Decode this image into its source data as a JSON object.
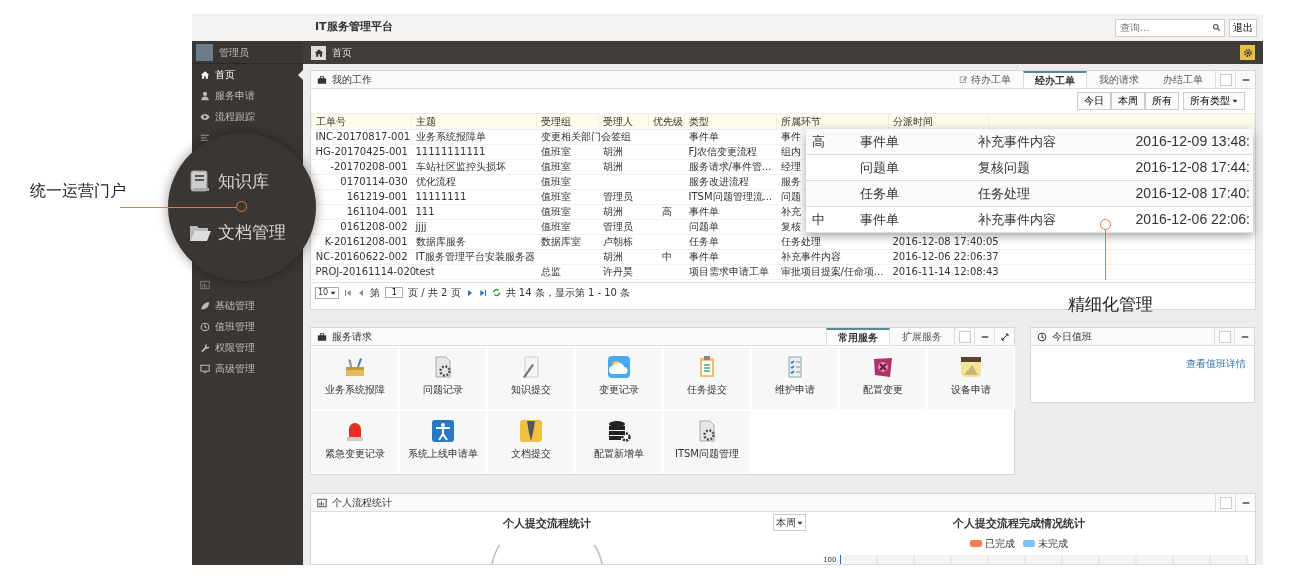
{
  "header": {
    "title": "IT服务管理平台",
    "search": {
      "placeholder": "查询..."
    },
    "logout": "退出"
  },
  "sidebar": {
    "user": "管理员",
    "items": [
      {
        "label": "首页",
        "selected": true
      },
      {
        "label": "服务申请",
        "selected": false
      },
      {
        "label": "流程跟踪",
        "selected": false
      },
      {
        "selected": false
      },
      {
        "selected": false
      },
      {
        "label": "基础管理",
        "selected": false
      },
      {
        "label": "值班管理",
        "selected": false
      },
      {
        "label": "权限管理",
        "selected": false
      },
      {
        "label": "高级管理",
        "selected": false
      }
    ]
  },
  "breadcrumb": "首页",
  "work_panel": {
    "title": "我的工作",
    "tabs": [
      {
        "label": "待办工单",
        "selected": false
      },
      {
        "label": "经办工单",
        "selected": true
      },
      {
        "label": "我的请求",
        "selected": false
      },
      {
        "label": "办结工单",
        "selected": false
      }
    ],
    "filters": [
      "今日",
      "本周",
      "所有"
    ],
    "type_dropdown": "所有类型",
    "columns": [
      "工单号",
      "主题",
      "受理组",
      "受理人",
      "优先级",
      "类型",
      "所属环节",
      "分派时间"
    ],
    "rows": [
      {
        "id": "INC-20170817-001",
        "subject": "业务系统报障单",
        "group": "变更相关部门会签组",
        "type": "事件单",
        "stage": "事件"
      },
      {
        "id": "HG-20170425-001",
        "subject": "11111111111",
        "group": "值班室",
        "assignee": "胡洲",
        "type": "FJ农信变更流程",
        "stage": "组内"
      },
      {
        "id": "-20170208-001",
        "subject": "车站社区监控头损坏",
        "group": "值班室",
        "assignee": "胡洲",
        "type": "服务请求/事件管...",
        "stage": "经理"
      },
      {
        "id": "0170114-030",
        "subject": "优化流程",
        "group": "值班室",
        "type": "服务改进流程",
        "stage": "服务"
      },
      {
        "id": "161219-001",
        "subject": "11111111",
        "group": "值班室",
        "assignee": "管理员",
        "type": "ITSM问题管理流...",
        "stage": "问题"
      },
      {
        "id": "161104-001",
        "subject": "111",
        "group": "值班室",
        "assignee": "胡洲",
        "priority": "高",
        "type": "事件单",
        "stage": "补充"
      },
      {
        "id": "0161208-002",
        "subject": "jjjj",
        "group": "值班室",
        "assignee": "管理员",
        "type": "问题单",
        "stage": "复核"
      },
      {
        "id": "K-20161208-001",
        "subject": "数据库服务",
        "group": "数据库室",
        "assignee": "卢朝栋",
        "type": "任务单",
        "stage": "任务处理",
        "time": "2016-12-08 17:40:05"
      },
      {
        "id": "NC-20160622-002",
        "subject": "IT服务管理平台安装服务器",
        "assignee": "胡洲",
        "priority": "中",
        "type": "事件单",
        "stage": "补充事件内容",
        "time": "2016-12-06 22:06:37"
      },
      {
        "id": "PROJ-20161114-020",
        "subject": "test",
        "group": "总监",
        "assignee": "许丹昊",
        "type": "项目需求申请工单",
        "stage": "审批项目提案/任命项...",
        "time": "2016-11-14 12:08:43"
      }
    ],
    "pager": {
      "page_size": "10",
      "before": "第",
      "page": "1",
      "after": "页 / 共 2 页",
      "summary": "共 14 条，显示第 1 - 10 条"
    }
  },
  "magnified_rows": [
    {
      "priority": "高",
      "type": "事件单",
      "stage": "补充事件内容",
      "time": "2016-12-09 13:48:"
    },
    {
      "type": "问题单",
      "stage": "复核问题",
      "time": "2016-12-08 17:44:"
    },
    {
      "type": "任务单",
      "stage": "任务处理",
      "time": "2016-12-08 17:40:"
    },
    {
      "priority": "中",
      "type": "事件单",
      "stage": "补充事件内容",
      "time": "2016-12-06 22:06:"
    }
  ],
  "magnifier": {
    "items": [
      {
        "label": "知识库"
      },
      {
        "label": "文档管理"
      }
    ]
  },
  "callouts": [
    {
      "text": "统一运营门户"
    },
    {
      "text": "精细化管理"
    }
  ],
  "service_panel": {
    "title": "服务请求",
    "tabs": [
      {
        "label": "常用服务",
        "selected": true
      },
      {
        "label": "扩展服务",
        "selected": false
      }
    ],
    "tiles": [
      {
        "label": "业务系统报障"
      },
      {
        "label": "问题记录"
      },
      {
        "label": "知识提交"
      },
      {
        "label": "变更记录"
      },
      {
        "label": "任务提交"
      },
      {
        "label": "维护申请"
      },
      {
        "label": "配置变更"
      },
      {
        "label": "设备申请"
      },
      {
        "label": "紧急变更记录"
      },
      {
        "label": "系统上线申请单"
      },
      {
        "label": "文档提交"
      },
      {
        "label": "配置新增单"
      },
      {
        "label": "ITSM问题管理"
      }
    ]
  },
  "duty_panel": {
    "title": "今日值班",
    "link": "查看值班详情"
  },
  "stats_panel": {
    "title": "个人流程统计",
    "left_title": "个人提交流程统计",
    "period": "本周",
    "right_title": "个人提交流程完成情况统计",
    "legend": [
      {
        "label": "已完成",
        "color": "#f07e4f"
      },
      {
        "label": "未完成",
        "color": "#7cc3f2"
      }
    ],
    "y_tick": "100"
  }
}
